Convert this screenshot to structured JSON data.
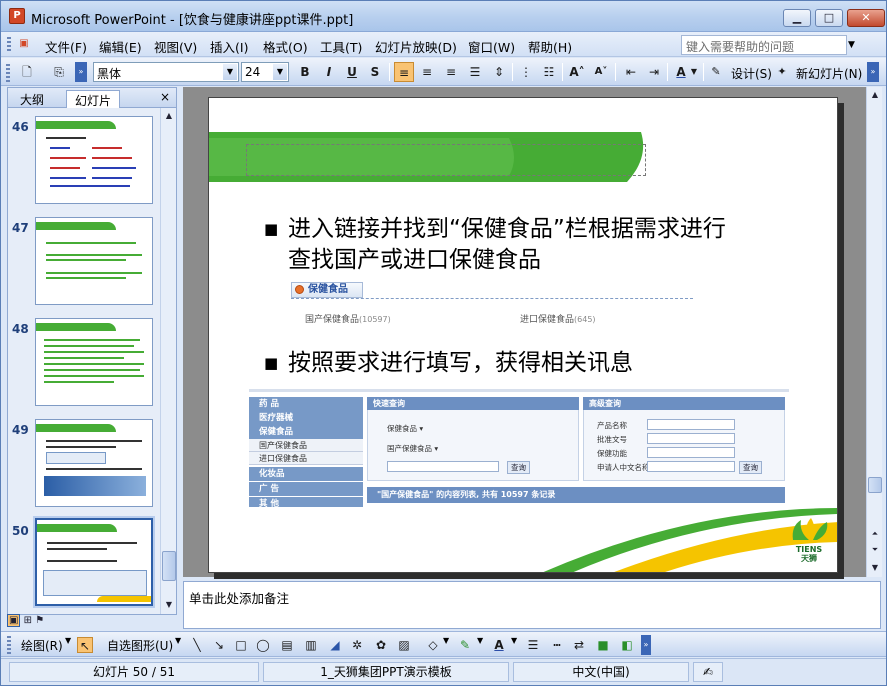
{
  "window": {
    "title": "Microsoft PowerPoint - [饮食与健康讲座ppt课件.ppt]",
    "app_icon": "powerpoint-icon"
  },
  "menu": {
    "items": [
      "文件(F)",
      "编辑(E)",
      "视图(V)",
      "插入(I)",
      "格式(O)",
      "工具(T)",
      "幻灯片放映(D)",
      "窗口(W)",
      "帮助(H)"
    ],
    "help_placeholder": "键入需要帮助的问题"
  },
  "toolbar": {
    "font_name": "黑体",
    "font_size": "24",
    "bold": "B",
    "italic": "I",
    "underline": "U",
    "shadow": "S",
    "design_label": "设计(S)",
    "new_slide_label": "新幻灯片(N)"
  },
  "left_panel": {
    "tabs": [
      "大纲",
      "幻灯片"
    ],
    "selected_tab": "幻灯片",
    "close": "×",
    "slide_numbers": [
      "46",
      "47",
      "48",
      "49",
      "50"
    ],
    "selected_slide": "50"
  },
  "slide": {
    "bullet1_line1": "进入链接并找到“保健食品”栏根据需求进行",
    "bullet1_line2": "查找国产或进口保健食品",
    "bullet2": "按照要求进行填写，获得相关讯息",
    "nav_image": {
      "header": "保健食品",
      "domestic": "国产保健食品",
      "domestic_count": "(10597)",
      "imported": "进口保健食品",
      "imported_count": "(645)"
    },
    "form_image": {
      "sidebar": [
        "药 品",
        "医疗器械",
        "保健食品",
        "国产保健食品",
        "进口保健食品",
        "化妆品",
        "广 告",
        "其 他"
      ],
      "quick_search_title": "快速查询",
      "advanced_search_title": "高级查询",
      "select1": "保健食品",
      "select2": "国产保健食品",
      "search_button": "查询",
      "fields": [
        "产品名称",
        "批准文号",
        "保健功能",
        "申请人中文名称"
      ],
      "result_text": "\"国产保健食品\" 的内容列表, 共有 10597 条记录"
    },
    "logo_text": "TIENS",
    "logo_cn": "天狮"
  },
  "notes": {
    "placeholder": "单击此处添加备注"
  },
  "drawbar": {
    "draw_label": "绘图(R)",
    "autoshape_label": "自选图形(U)"
  },
  "status": {
    "slide_info": "幻灯片 50 / 51",
    "template": "1_天狮集团PPT演示模板",
    "language": "中文(中国)"
  },
  "colors": {
    "accent_green": "#46ac35",
    "accent_yellow": "#f5c400",
    "active_button": "#f9c373"
  }
}
